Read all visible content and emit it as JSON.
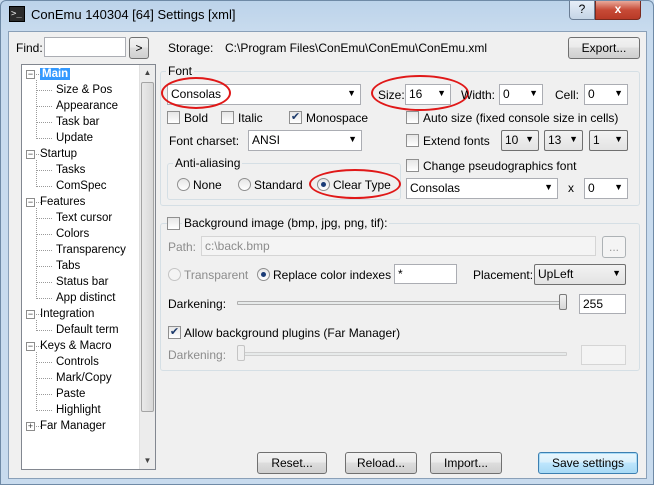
{
  "window": {
    "title": "ConEmu 140304 [64] Settings [xml]",
    "help_label": "?",
    "close_label": "x"
  },
  "find": {
    "label": "Find:",
    "value": "",
    "go_label": ">"
  },
  "storage": {
    "label": "Storage:",
    "path": "C:\\Program Files\\ConEmu\\ConEmu\\ConEmu.xml",
    "export_label": "Export..."
  },
  "tree": {
    "nodes": [
      {
        "label": "Main",
        "level": 0,
        "expander": "−",
        "selected": true
      },
      {
        "label": "Size & Pos",
        "level": 1
      },
      {
        "label": "Appearance",
        "level": 1
      },
      {
        "label": "Task bar",
        "level": 1
      },
      {
        "label": "Update",
        "level": 1
      },
      {
        "label": "Startup",
        "level": 0,
        "expander": "−"
      },
      {
        "label": "Tasks",
        "level": 1
      },
      {
        "label": "ComSpec",
        "level": 1
      },
      {
        "label": "Features",
        "level": 0,
        "expander": "−"
      },
      {
        "label": "Text cursor",
        "level": 1
      },
      {
        "label": "Colors",
        "level": 1
      },
      {
        "label": "Transparency",
        "level": 1
      },
      {
        "label": "Tabs",
        "level": 1
      },
      {
        "label": "Status bar",
        "level": 1
      },
      {
        "label": "App distinct",
        "level": 1
      },
      {
        "label": "Integration",
        "level": 0,
        "expander": "−"
      },
      {
        "label": "Default term",
        "level": 1
      },
      {
        "label": "Keys & Macro",
        "level": 0,
        "expander": "−"
      },
      {
        "label": "Controls",
        "level": 1
      },
      {
        "label": "Mark/Copy",
        "level": 1
      },
      {
        "label": "Paste",
        "level": 1
      },
      {
        "label": "Highlight",
        "level": 1
      },
      {
        "label": "Far Manager",
        "level": 0,
        "expander": "+"
      }
    ]
  },
  "font": {
    "group_label": "Font",
    "face": "Consolas",
    "size_label": "Size:",
    "size_value": "16",
    "width_label": "Width:",
    "width_value": "0",
    "cell_label": "Cell:",
    "cell_value": "0",
    "bold_label": "Bold",
    "bold_checked": false,
    "italic_label": "Italic",
    "italic_checked": false,
    "monospace_label": "Monospace",
    "monospace_checked": true,
    "autosize_label": "Auto size (fixed console size in cells)",
    "autosize_checked": false,
    "charset_label": "Font charset:",
    "charset_value": "ANSI",
    "extend_label": "Extend fonts",
    "extend_checked": false,
    "extend_v1": "10",
    "extend_v2": "13",
    "extend_v3": "1",
    "antialias_label": "Anti-aliasing",
    "aa_none": "None",
    "aa_standard": "Standard",
    "aa_cleartype": "Clear Type",
    "aa_selected": "Clear Type",
    "pseudo_label": "Change pseudographics font",
    "pseudo_checked": false,
    "pseudo_face": "Consolas",
    "pseudo_x": "x",
    "pseudo_size": "0"
  },
  "background": {
    "image_label": "Background image (bmp, jpg, png, tif):",
    "image_checked": false,
    "path_label": "Path:",
    "path_value": "c:\\back.bmp",
    "browse_label": "...",
    "transparent_label": "Transparent",
    "replace_label": "Replace color indexes",
    "mode_selected": "Replace color indexes",
    "indexes_value": "*",
    "placement_label": "Placement:",
    "placement_value": "UpLeft",
    "darkening_label": "Darkening:",
    "darkening_value": "255",
    "darkening_fraction": 1.0,
    "plugins_label": "Allow background plugins (Far Manager)",
    "plugins_checked": true,
    "darkening2_label": "Darkening:",
    "darkening2_value": "",
    "darkening2_fraction": 0.0
  },
  "footer": {
    "reset": "Reset...",
    "reload": "Reload...",
    "import": "Import...",
    "save": "Save settings"
  },
  "colors": {
    "highlight": "#e01818",
    "selection": "#3399ff"
  }
}
